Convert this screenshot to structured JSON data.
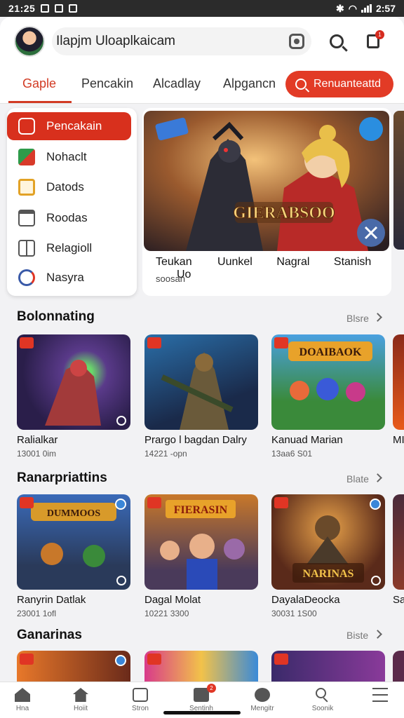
{
  "status": {
    "time": "21:25",
    "right_time": "2:57"
  },
  "header": {
    "search_text": "Ilapjm Uloaplkaicam",
    "notification_count": "1"
  },
  "tabs": [
    {
      "label": "Gaple",
      "active": true
    },
    {
      "label": "Pencakin"
    },
    {
      "label": "Alcadlay"
    },
    {
      "label": "Alpgancn"
    }
  ],
  "tab_button": {
    "label": "Renuanteattd"
  },
  "sidemenu": [
    {
      "label": "Pencakain",
      "icon": "puzzle-icon",
      "active": true
    },
    {
      "label": "Nohaclt",
      "icon": "game-grid-icon"
    },
    {
      "label": "Datods",
      "icon": "folder-icon"
    },
    {
      "label": "Roodas",
      "icon": "calendar-icon"
    },
    {
      "label": "Relagioll",
      "icon": "tag-icon"
    },
    {
      "label": "Nasyra",
      "icon": "link-icon"
    }
  ],
  "hero": {
    "title_art": "GIERABSOO",
    "categories": [
      "Teukan",
      "Uunkel",
      "Nagral",
      "Stanish",
      "Uo"
    ],
    "subtitle": "soosan"
  },
  "sections": [
    {
      "title": "Bolonnating",
      "more": "Blsre",
      "items": [
        {
          "title": "Ralialkar",
          "sub": "13001 0im"
        },
        {
          "title": "Prargo l bagdan Dalry",
          "sub": "14221 -opn"
        },
        {
          "title": "Kanuad Marian",
          "sub": "13aa6 S01"
        },
        {
          "title": "MI",
          "sub": ""
        }
      ]
    },
    {
      "title": "Ranarpriattins",
      "more": "Blate",
      "items": [
        {
          "title": "Ranyrin Datlak",
          "sub": "23001 1ofl"
        },
        {
          "title": "Dagal Molat",
          "sub": "10221 3300"
        },
        {
          "title": "DayalaDeocka",
          "sub": "30031 1S00"
        },
        {
          "title": "Sa",
          "sub": ""
        }
      ]
    },
    {
      "title": "Ganarinas",
      "more": "Biste",
      "items": [
        {
          "title": "",
          "sub": ""
        },
        {
          "title": "",
          "sub": ""
        },
        {
          "title": "",
          "sub": ""
        },
        {
          "title": "",
          "sub": ""
        }
      ]
    }
  ],
  "art_titles": {
    "s1_2": "DOAIBAOK",
    "s2_0": "DUMMOOS",
    "s2_1": "FIERASIN",
    "s2_2": "NARINAS"
  },
  "bottom_nav": [
    {
      "label": "Hna",
      "icon": "home-icon"
    },
    {
      "label": "Hoiit",
      "icon": "house-icon"
    },
    {
      "label": "Stron",
      "icon": "store-icon"
    },
    {
      "label": "Sentinh",
      "icon": "bag-icon",
      "badge": "2"
    },
    {
      "label": "Mengitr",
      "icon": "compass-icon"
    },
    {
      "label": "Soonik",
      "icon": "search-icon"
    },
    {
      "label": "",
      "icon": "menu-icon"
    }
  ],
  "colors": {
    "accent": "#d8301d",
    "background": "#f2f2f4"
  }
}
